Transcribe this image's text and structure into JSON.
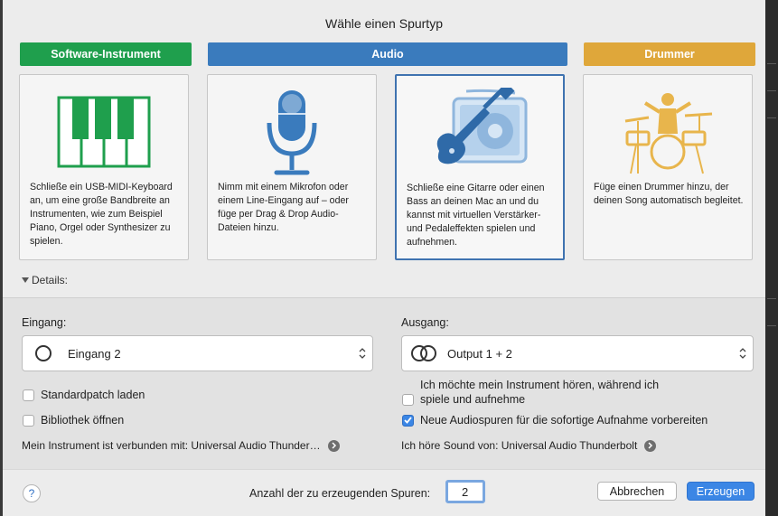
{
  "dialog": {
    "title": "Wähle einen Spurtyp"
  },
  "categories": [
    {
      "label": "Software-Instrument",
      "color": "#1f9f4d"
    },
    {
      "label": "Audio",
      "color": "#3a7bbd"
    },
    {
      "label": "Drummer",
      "color": "#dfa73a"
    }
  ],
  "cards": [
    {
      "icon": "piano-keys-icon",
      "description": "Schließe ein USB-MIDI-Keyboard an, um eine große Bandbreite an Instrumenten, wie zum Beispiel Piano, Orgel oder Synthesizer zu spielen.",
      "selected": false
    },
    {
      "icon": "microphone-icon",
      "description": "Nimm mit einem Mikrofon oder einem Line-Eingang auf – oder füge per Drag & Drop Audio-Dateien hinzu.",
      "selected": false
    },
    {
      "icon": "guitar-amp-icon",
      "description": "Schließe eine Gitarre oder einen Bass an deinen Mac an und du kannst mit virtuellen Verstärker-und Pedaleffekten spielen und aufnehmen.",
      "selected": true
    },
    {
      "icon": "drummer-icon",
      "description": "Füge einen Drummer hinzu, der deinen Song automatisch begleitet.",
      "selected": false
    }
  ],
  "details": {
    "label": "Details:"
  },
  "input": {
    "label": "Eingang:",
    "value": "Eingang 2",
    "standard_patch": "Standardpatch laden",
    "standard_patch_checked": false,
    "open_library": "Bibliothek öffnen",
    "open_library_checked": false,
    "connected": "Mein Instrument ist verbunden mit: Universal Audio Thunder…"
  },
  "output": {
    "label": "Ausgang:",
    "value": "Output 1 + 2",
    "monitor_line1": "Ich möchte mein Instrument hören, während ich",
    "monitor_line2": "spiele und aufnehme",
    "monitor_checked": false,
    "record_enable": "Neue Audiospuren für die sofortige Aufnahme vorbereiten",
    "record_enable_checked": true,
    "sound_from": "Ich höre Sound von: Universal Audio Thunderbolt"
  },
  "footer": {
    "help": "?",
    "count_label": "Anzahl der zu erzeugenden Spuren:",
    "count_value": "2",
    "cancel": "Abbrechen",
    "create": "Erzeugen"
  }
}
